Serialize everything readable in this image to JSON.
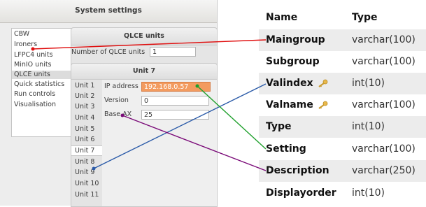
{
  "window": {
    "title": "System settings",
    "nav_items": [
      "CBW",
      "Ironers",
      "LFPC4 units",
      "MinIO units",
      "QLCE units",
      "Quick statistics",
      "Run controls",
      "Visualisation"
    ],
    "nav_selected_index": 4
  },
  "qlce_panel": {
    "title": "QLCE units",
    "count_label": "Number of QLCE units",
    "count_value": "1"
  },
  "unit_panel": {
    "title": "Unit 7",
    "tabs": [
      "Unit 1",
      "Unit 2",
      "Unit 3",
      "Unit 4",
      "Unit 5",
      "Unit 6",
      "Unit 7",
      "Unit 8",
      "Unit 9",
      "Unit 10",
      "Unit 11"
    ],
    "selected_tab_index": 6,
    "fields": [
      {
        "label": "IP address",
        "value": "192.168.0.57"
      },
      {
        "label": "Version",
        "value": "0"
      },
      {
        "label": "Base AX",
        "value": "25"
      }
    ]
  },
  "table": {
    "header": {
      "name": "Name",
      "type": "Type"
    },
    "rows": [
      {
        "name": "Maingroup",
        "type": "varchar(100)",
        "key": false
      },
      {
        "name": "Subgroup",
        "type": "varchar(100)",
        "key": false
      },
      {
        "name": "Valindex",
        "type": "int(10)",
        "key": true
      },
      {
        "name": "Valname",
        "type": "varchar(100)",
        "key": true
      },
      {
        "name": "Type",
        "type": "int(10)",
        "key": false
      },
      {
        "name": "Setting",
        "type": "varchar(100)",
        "key": false
      },
      {
        "name": "Description",
        "type": "varchar(250)",
        "key": false
      },
      {
        "name": "Displayorder",
        "type": "int(10)",
        "key": false
      }
    ]
  },
  "links": [
    {
      "from": "nav:Ironers",
      "to": "row:Maingroup",
      "color": "#e01010"
    },
    {
      "from": "tab:Unit 9",
      "to": "row:Valindex",
      "color": "#2a5aa8"
    },
    {
      "from": "field:IP address",
      "to": "row:Setting",
      "color": "#1fa02c"
    },
    {
      "from": "field:Base AX",
      "to": "row:Description",
      "color": "#7a0a78"
    }
  ],
  "colors": {
    "highlight_field": "#f39b5f",
    "key_icon": "#e8b84a"
  }
}
